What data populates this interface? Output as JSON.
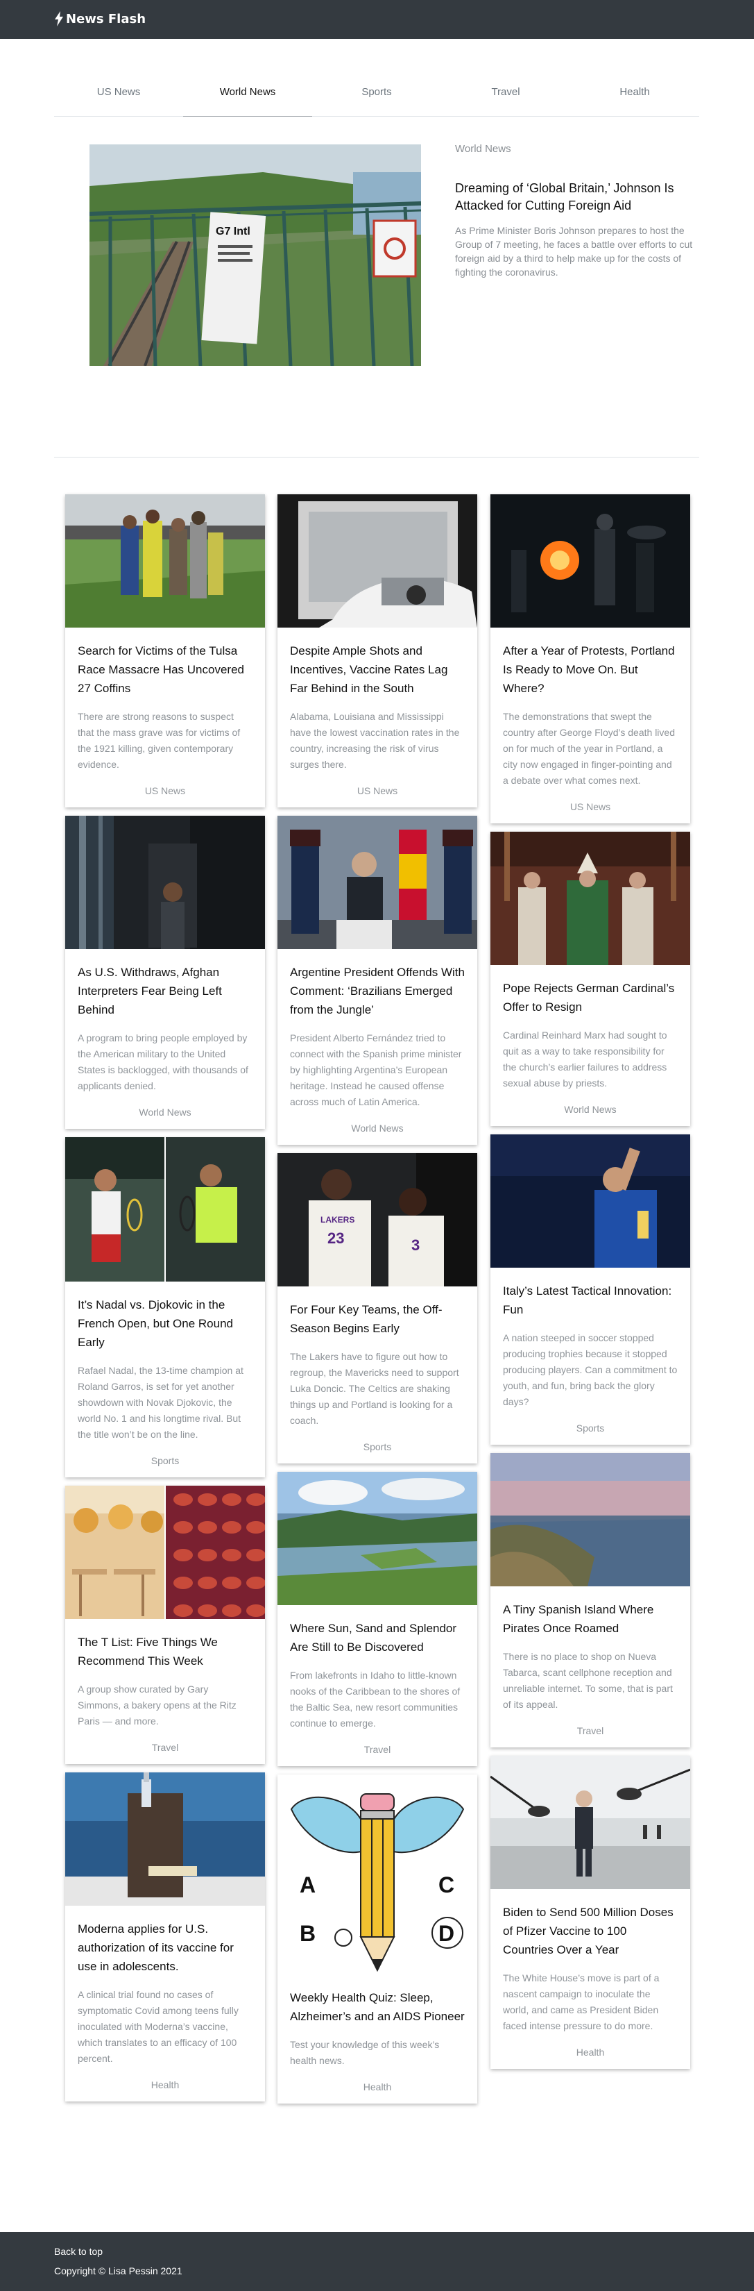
{
  "brand": {
    "name": "News Flash",
    "icon": "lightning-bolt-icon"
  },
  "tabs": [
    "US News",
    "World News",
    "Sports",
    "Travel",
    "Health"
  ],
  "active_tab": "World News",
  "hero": {
    "category": "World News",
    "title": "Dreaming of ‘Global Britain,’ Johnson Is Attacked for Cutting Foreign Aid",
    "description": "As Prime Minister Boris Johnson prepares to host the Group of 7 meeting, he faces a battle over efforts to cut foreign aid by a third to help make up for the costs of fighting the coronavirus.",
    "sign_text": "G7 Intl"
  },
  "columns": [
    [
      {
        "title": "Search for Victims of the Tulsa Race Massacre Has Uncovered 27 Coffins",
        "description": "There are strong reasons to suspect that the mass grave was for victims of the 1921 killing, given contemporary evidence.",
        "category": "US News"
      },
      {
        "title": "As U.S. Withdraws, Afghan Interpreters Fear Being Left Behind",
        "description": "A program to bring people employed by the American military to the United States is backlogged, with thousands of applicants denied.",
        "category": "World News"
      },
      {
        "title": "It’s Nadal vs. Djokovic in the French Open, but One Round Early",
        "description": "Rafael Nadal, the 13-time champion at Roland Garros, is set for yet another showdown with Novak Djokovic, the world No. 1 and his longtime rival. But the title won’t be on the line.",
        "category": "Sports"
      },
      {
        "title": "The T List: Five Things We Recommend This Week",
        "description": "A group show curated by Gary Simmons, a bakery opens at the Ritz Paris — and more.",
        "category": "Travel"
      },
      {
        "title": "Moderna applies for U.S. authorization of its vaccine for use in adolescents.",
        "description": "A clinical trial found no cases of symptomatic Covid among teens fully inoculated with Moderna’s vaccine, which translates to an efficacy of 100 percent.",
        "category": "Health"
      }
    ],
    [
      {
        "title": "Despite Ample Shots and Incentives, Vaccine Rates Lag Far Behind in the South",
        "description": "Alabama, Louisiana and Mississippi have the lowest vaccination rates in the country, increasing the risk of virus surges there.",
        "category": "US News"
      },
      {
        "title": "Argentine President Offends With Comment: ‘Brazilians Emerged from the Jungle’",
        "description": "President Alberto Fernández tried to connect with the Spanish prime minister by highlighting Argentina’s European heritage. Instead he caused offense across much of Latin America.",
        "category": "World News"
      },
      {
        "title": "For Four Key Teams, the Off-Season Begins Early",
        "description": "The Lakers have to figure out how to regroup, the Mavericks need to support Luka Doncic. The Celtics are shaking things up and Portland is looking for a coach.",
        "category": "Sports",
        "jersey_numbers": [
          "23",
          "3"
        ],
        "jersey_team": "LAKERS"
      },
      {
        "title": "Where Sun, Sand and Splendor Are Still to Be Discovered",
        "description": "From lakefronts in Idaho to little-known nooks of the Caribbean to the shores of the Baltic Sea, new resort communities continue to emerge.",
        "category": "Travel"
      },
      {
        "title": "Weekly Health Quiz: Sleep, Alzheimer’s and an AIDS Pioneer",
        "description": "Test your knowledge of this week’s health news.",
        "category": "Health",
        "quiz_letters": [
          "A",
          "B",
          "C",
          "D"
        ]
      }
    ],
    [
      {
        "title": "After a Year of Protests, Portland Is Ready to Move On. But Where?",
        "description": "The demonstrations that swept the country after George Floyd’s death lived on for much of the year in Portland, a city now engaged in finger-pointing and a debate over what comes next.",
        "category": "US News"
      },
      {
        "title": "Pope Rejects German Cardinal’s Offer to Resign",
        "description": "Cardinal Reinhard Marx had sought to quit as a way to take responsibility for the church’s earlier failures to address sexual abuse by priests.",
        "category": "World News"
      },
      {
        "title": "Italy’s Latest Tactical Innovation: Fun",
        "description": "A nation steeped in soccer stopped producing trophies because it stopped producing players. Can a commitment to youth, and fun, bring back the glory days?",
        "category": "Sports"
      },
      {
        "title": "A Tiny Spanish Island Where Pirates Once Roamed",
        "description": "There is no place to shop on Nueva Tabarca, scant cellphone reception and unreliable internet. To some, that is part of its appeal.",
        "category": "Travel"
      },
      {
        "title": "Biden to Send 500 Million Doses of Pfizer Vaccine to 100 Countries Over a Year",
        "description": "The White House’s move is part of a nascent campaign to inoculate the world, and came as President Biden faced intense pressure to do more.",
        "category": "Health"
      }
    ]
  ],
  "footer": {
    "back_to_top": "Back to top",
    "copyright": "Copyright © Lisa Pessin 2021"
  }
}
